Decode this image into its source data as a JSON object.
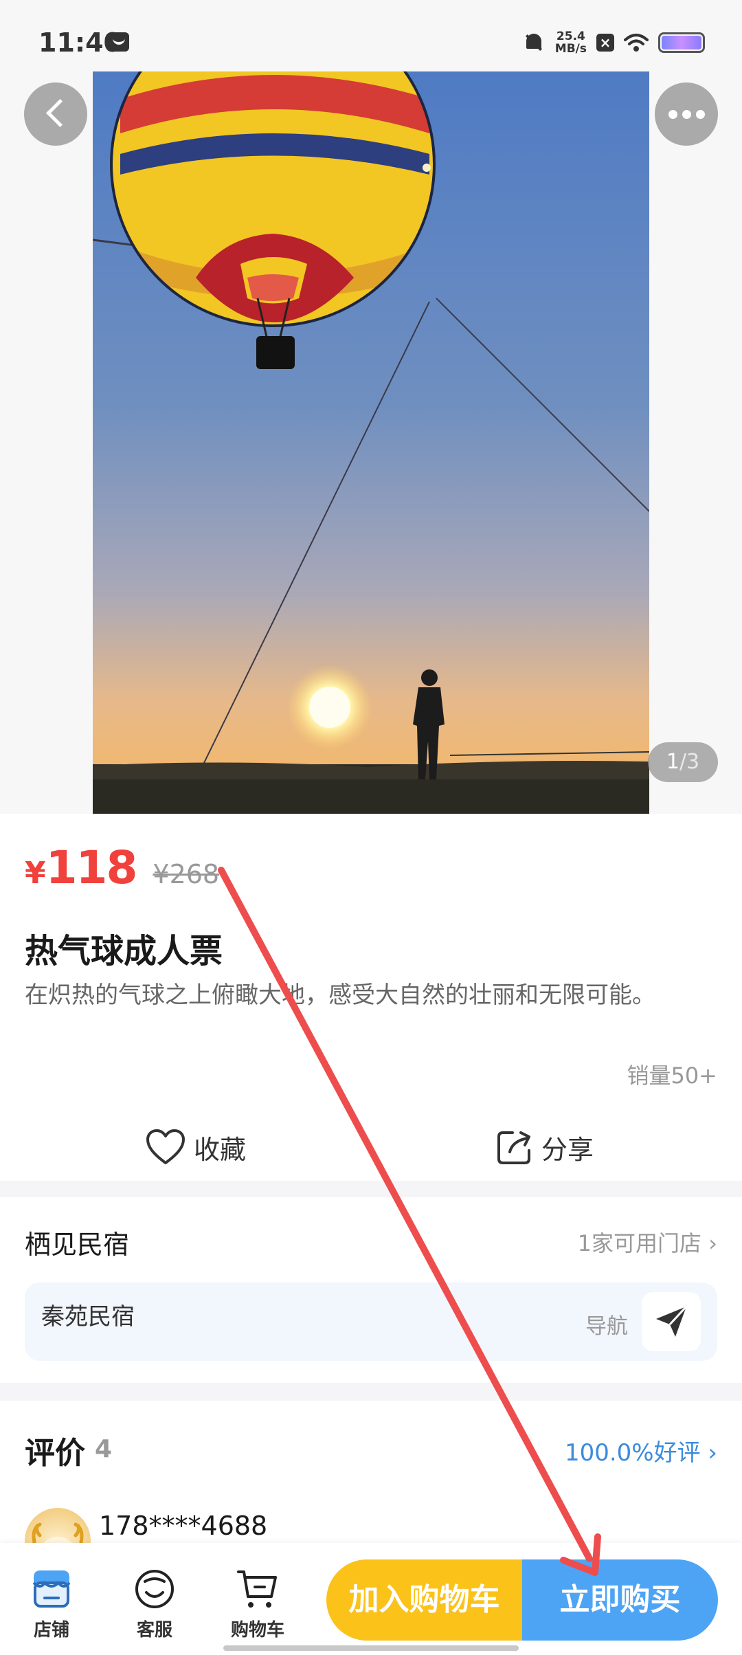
{
  "status_bar": {
    "time": "11:40",
    "net_speed_value": "25.4",
    "net_speed_unit": "MB/s",
    "x_badge": "×",
    "icons": [
      "message-icon",
      "bell-muted-icon",
      "wifi-icon",
      "battery-icon"
    ]
  },
  "hero": {
    "page_current": "1",
    "page_separator": "/",
    "page_total": "3",
    "icons": [
      "back-arrow-icon",
      "more-dots-icon"
    ]
  },
  "product": {
    "price_symbol": "¥",
    "price": "118",
    "original_price": "¥268",
    "title": "热气球成人票",
    "description": "在炽热的气球之上俯瞰大地，感受大自然的壮丽和无限可能。",
    "sales": "销量50+",
    "favorite_label": "收藏",
    "share_label": "分享",
    "price_color": "#f0413c"
  },
  "shop": {
    "name": "栖见民宿",
    "stores_link": "1家可用门店 ›",
    "store_name": "秦苑民宿",
    "navigate_label": "导航"
  },
  "reviews": {
    "title": "评价",
    "count": "4",
    "good_rate": "100.0%好评 ›",
    "reviewer_name": "178****4688",
    "accent_color": "#3c8bdc"
  },
  "bottom_bar": {
    "tabs": [
      {
        "label": "店铺",
        "icon": "shop-icon"
      },
      {
        "label": "客服",
        "icon": "customer-service-icon"
      },
      {
        "label": "购物车",
        "icon": "cart-icon"
      }
    ],
    "add_cart_label": "加入购物车",
    "buy_now_label": "立即购买",
    "add_cart_color": "#fbc21a",
    "buy_now_color": "#4da4f5"
  }
}
